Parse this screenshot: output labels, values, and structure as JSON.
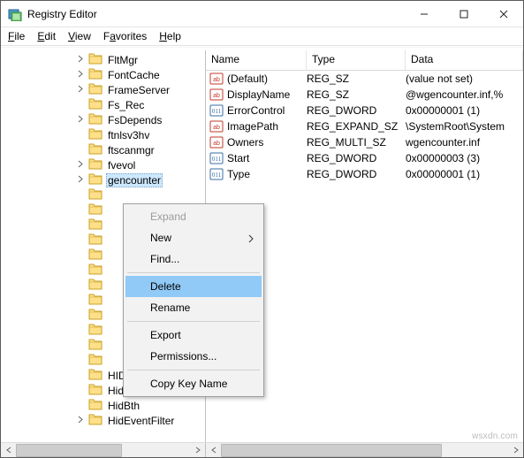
{
  "window": {
    "title": "Registry Editor"
  },
  "menubar": [
    {
      "label": "File",
      "u": 0
    },
    {
      "label": "Edit",
      "u": 0
    },
    {
      "label": "View",
      "u": 0
    },
    {
      "label": "Favorites",
      "u": 1
    },
    {
      "label": "Help",
      "u": 0
    }
  ],
  "tree": {
    "items": [
      {
        "label": "FltMgr",
        "expandable": true
      },
      {
        "label": "FontCache",
        "expandable": true
      },
      {
        "label": "FrameServer",
        "expandable": true
      },
      {
        "label": "Fs_Rec",
        "expandable": false
      },
      {
        "label": "FsDepends",
        "expandable": true
      },
      {
        "label": "ftnlsv3hv",
        "expandable": false
      },
      {
        "label": "ftscanmgr",
        "expandable": false
      },
      {
        "label": "fvevol",
        "expandable": true
      },
      {
        "label": "gencounter",
        "expandable": true,
        "selected": true
      },
      {
        "label": "",
        "expandable": false
      },
      {
        "label": "",
        "expandable": false
      },
      {
        "label": "",
        "expandable": false
      },
      {
        "label": "",
        "expandable": false
      },
      {
        "label": "",
        "expandable": false
      },
      {
        "label": "",
        "expandable": false
      },
      {
        "label": "",
        "expandable": false
      },
      {
        "label": "",
        "expandable": false
      },
      {
        "label": "",
        "expandable": false
      },
      {
        "label": "",
        "expandable": false
      },
      {
        "label": "",
        "expandable": false
      },
      {
        "label": "",
        "expandable": false
      },
      {
        "label": "HID_PCI",
        "expandable": false
      },
      {
        "label": "HidBatt",
        "expandable": false
      },
      {
        "label": "HidBth",
        "expandable": false
      },
      {
        "label": "HidEventFilter",
        "expandable": true
      }
    ]
  },
  "list": {
    "headers": {
      "name": "Name",
      "type": "Type",
      "data": "Data"
    },
    "rows": [
      {
        "icon": "sz",
        "name": "(Default)",
        "type": "REG_SZ",
        "data": "(value not set)"
      },
      {
        "icon": "sz",
        "name": "DisplayName",
        "type": "REG_SZ",
        "data": "@wgencounter.inf,%"
      },
      {
        "icon": "dword",
        "name": "ErrorControl",
        "type": "REG_DWORD",
        "data": "0x00000001 (1)"
      },
      {
        "icon": "sz",
        "name": "ImagePath",
        "type": "REG_EXPAND_SZ",
        "data": "\\SystemRoot\\System"
      },
      {
        "icon": "sz",
        "name": "Owners",
        "type": "REG_MULTI_SZ",
        "data": "wgencounter.inf"
      },
      {
        "icon": "dword",
        "name": "Start",
        "type": "REG_DWORD",
        "data": "0x00000003 (3)"
      },
      {
        "icon": "dword",
        "name": "Type",
        "type": "REG_DWORD",
        "data": "0x00000001 (1)"
      }
    ]
  },
  "context_menu": {
    "groups": [
      [
        {
          "label": "Expand",
          "disabled": true
        },
        {
          "label": "New",
          "submenu": true
        },
        {
          "label": "Find..."
        }
      ],
      [
        {
          "label": "Delete",
          "highlight": true
        },
        {
          "label": "Rename"
        }
      ],
      [
        {
          "label": "Export"
        },
        {
          "label": "Permissions..."
        }
      ],
      [
        {
          "label": "Copy Key Name"
        }
      ]
    ]
  },
  "watermark": "wsxdn.com"
}
